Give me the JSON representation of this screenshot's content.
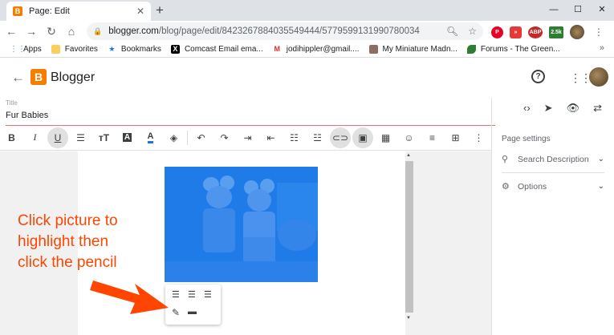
{
  "browser": {
    "tab_title": "Page: Edit",
    "tab_icon": "B",
    "new_tab": "+",
    "url_host": "blogger.com",
    "url_path": "/blog/page/edit/8423267884035549444/5779599131990780034",
    "window_controls": [
      "—",
      "☐",
      "✕"
    ],
    "extensions": [
      {
        "name": "pinterest-icon",
        "label": "P",
        "color": "#e60023"
      },
      {
        "name": "forward-icon",
        "label": "»",
        "color": "#e53935"
      },
      {
        "name": "adblock-icon",
        "label": "ABP",
        "color": "#c62828"
      },
      {
        "name": "counter-icon",
        "label": "2.5k",
        "color": "#2e7d32"
      }
    ]
  },
  "bookmarks": [
    {
      "label": "Apps",
      "icon": "apps-icon",
      "color": "#4285f4"
    },
    {
      "label": "Favorites",
      "icon": "folder-icon",
      "color": "#f9ce5d"
    },
    {
      "label": "Bookmarks",
      "icon": "star-icon",
      "color": "#1a73e8"
    },
    {
      "label": "Comcast Email ema...",
      "icon": "x-icon",
      "color": "#000000"
    },
    {
      "label": "jodihippler@gmail....",
      "icon": "gmail-icon",
      "color": "#d93025"
    },
    {
      "label": "My Miniature Madn...",
      "icon": "image-icon",
      "color": "#8d6e63"
    },
    {
      "label": "Forums - The Green...",
      "icon": "leaf-icon",
      "color": "#2e7d32"
    }
  ],
  "bookmarks_more": "»",
  "blogger": {
    "name": "Blogger",
    "title_label": "Title",
    "title_value": "Fur Babies"
  },
  "sidebar": {
    "header": "Page settings",
    "search_description": "Search Description",
    "options": "Options"
  },
  "annotation": {
    "lines": [
      "Click picture to",
      "highlight then",
      "click the pencil"
    ]
  },
  "colors": {
    "accent": "#ff4500",
    "blogger_orange": "#f57d00",
    "selection_blue": "#1f7be8"
  }
}
